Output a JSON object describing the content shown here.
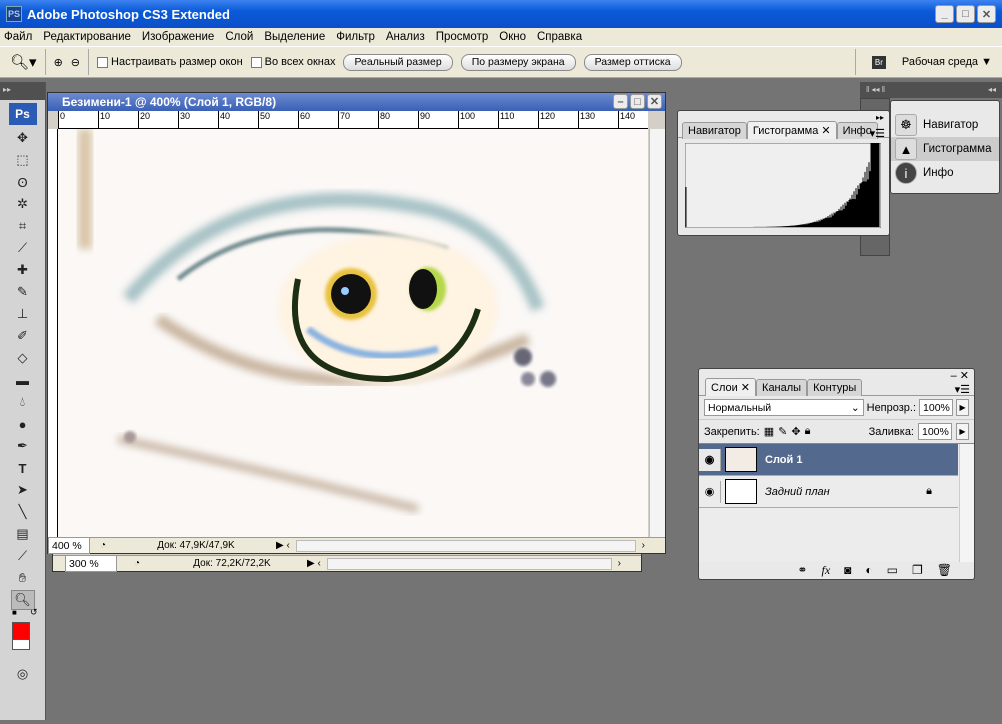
{
  "app": {
    "title": "Adobe Photoshop CS3 Extended",
    "icon": "PS"
  },
  "menu": [
    "Файл",
    "Редактирование",
    "Изображение",
    "Слой",
    "Выделение",
    "Фильтр",
    "Анализ",
    "Просмотр",
    "Окно",
    "Справка"
  ],
  "options": {
    "resize_windows": "Настраивать размер окон",
    "all_windows": "Во всех окнах",
    "actual_pixels": "Реальный размер",
    "fit_screen": "По размеру экрана",
    "print_size": "Размер оттиска",
    "workspace": "Рабочая среда ▼",
    "bridge": "Br"
  },
  "document": {
    "title": "Безимени-1 @ 400% (Слой 1, RGB/8)",
    "zoom": "400 %",
    "doc_size": "Док: 47,9K/47,9K",
    "ruler": [
      "0",
      "10",
      "20",
      "30",
      "40",
      "50",
      "60",
      "70",
      "80",
      "90",
      "100",
      "110",
      "120",
      "130",
      "140"
    ]
  },
  "document_back": {
    "zoom": "300 %",
    "doc_size": "Док: 72,2K/72,2K"
  },
  "histogram_panel": {
    "tabs": [
      "Навигатор",
      "Гистограмма",
      "Инфо"
    ],
    "active": 1
  },
  "dock": {
    "items": [
      {
        "label": "Навигатор",
        "icon": "navigator-icon"
      },
      {
        "label": "Гистограмма",
        "icon": "histogram-icon"
      },
      {
        "label": "Инфо",
        "icon": "info-icon"
      }
    ]
  },
  "layers_panel": {
    "tabs": [
      "Слои",
      "Каналы",
      "Контуры"
    ],
    "blend_mode": "Нормальный",
    "opacity_label": "Непрозр.:",
    "opacity": "100%",
    "lock_label": "Закрепить:",
    "fill_label": "Заливка:",
    "fill": "100%",
    "layers": [
      {
        "name": "Слой 1",
        "selected": true
      },
      {
        "name": "Задний план",
        "selected": false,
        "locked": true
      }
    ]
  },
  "colors": {
    "foreground": "#ff0000",
    "background": "#ffffff",
    "selection": "#536a8e"
  }
}
